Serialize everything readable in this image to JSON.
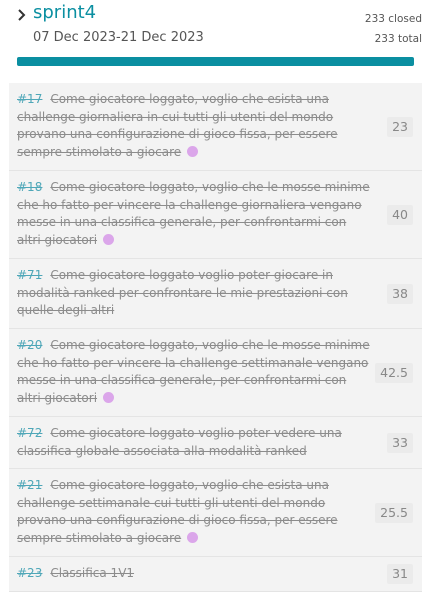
{
  "sprint": {
    "name": "sprint4",
    "dates": "07 Dec 2023-21 Dec 2023",
    "closed": "233 closed",
    "total": "233 total",
    "progress": 1.0,
    "accent": "#0b8fa1"
  },
  "stories": [
    {
      "ref": "#17",
      "text": "Come giocatore loggato, voglio che esista una challenge giornaliera in cui tutti gli utenti del mondo provano una configurazione di gioco fissa, per essere sempre stimolato a giocare",
      "points": "23",
      "tag": true
    },
    {
      "ref": "#18",
      "text": "Come giocatore loggato, voglio che le mosse minime che ho fatto per vincere la challenge giornaliera vengano messe in una classifica generale, per confrontarmi con altri giocatori",
      "points": "40",
      "tag": true
    },
    {
      "ref": "#71",
      "text": "Come giocatore loggato voglio poter giocare in modalità ranked per confrontare le mie prestazioni con quelle degli altri",
      "points": "38",
      "tag": false
    },
    {
      "ref": "#20",
      "text": "Come giocatore loggato, voglio che le mosse minime che ho fatto per vincere la challenge settimanale vengano messe in una classifica generale, per confrontarmi con altri giocatori",
      "points": "42.5",
      "tag": true
    },
    {
      "ref": "#72",
      "text": "Come giocatore loggato voglio poter vedere una classifica globale associata alla modalità ranked",
      "points": "33",
      "tag": false
    },
    {
      "ref": "#21",
      "text": "Come giocatore loggato, voglio che esista una challenge settimanale cui tutti gli utenti del mondo provano una configurazione di gioco fissa, per essere sempre stimolato a giocare",
      "points": "25.5",
      "tag": true
    },
    {
      "ref": "#23",
      "text": "Classifica 1V1",
      "points": "31",
      "tag": false
    }
  ],
  "tag_color": "#dba6ea"
}
